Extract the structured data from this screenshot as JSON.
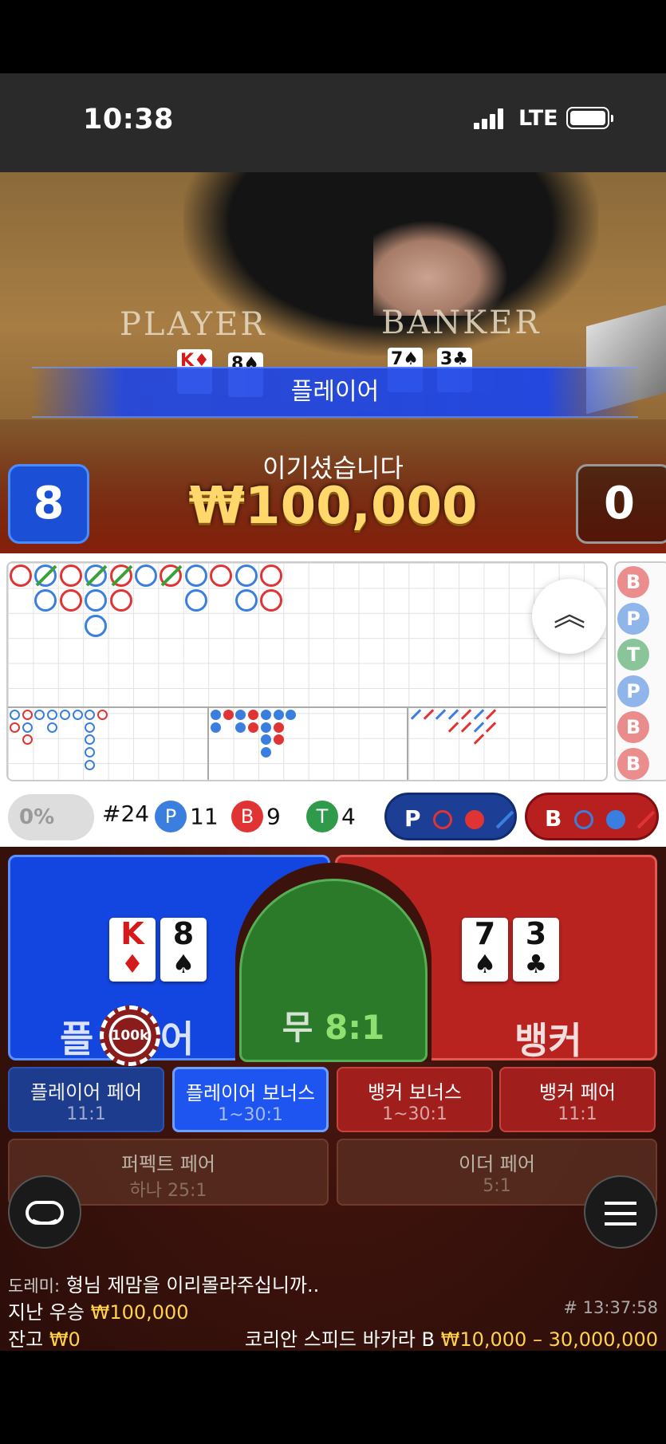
{
  "status": {
    "time": "10:38",
    "network": "LTE"
  },
  "table": {
    "player_label": "PLAYER",
    "banker_label": "BANKER"
  },
  "result": {
    "banner": "플레이어",
    "win_title": "이기셨습니다",
    "win_amount": "₩100,000",
    "player_score": "8",
    "banker_score": "0"
  },
  "stats": {
    "percent": "0%",
    "round": "#24",
    "player": {
      "badge": "P",
      "count": "11"
    },
    "banker": {
      "badge": "B",
      "count": "9"
    },
    "tie": {
      "badge": "T",
      "count": "4"
    },
    "ask_player": "P",
    "ask_banker": "B"
  },
  "prediction": [
    "B",
    "P",
    "T",
    "P",
    "B",
    "B"
  ],
  "bets": {
    "player": {
      "label_a": "플",
      "label_b": "어",
      "cards": [
        {
          "rank": "K",
          "suit": "♦"
        },
        {
          "rank": "8",
          "suit": "♠"
        }
      ]
    },
    "tie": {
      "label": "무",
      "odds": "8:1"
    },
    "banker": {
      "label": "뱅커",
      "cards": [
        {
          "rank": "7",
          "suit": "♠"
        },
        {
          "rank": "3",
          "suit": "♣"
        }
      ]
    },
    "chip": "100k"
  },
  "side_bets": [
    {
      "label": "플레이어 페어",
      "odds": "11:1"
    },
    {
      "label": "플레이어 보너스",
      "odds": "1~30:1"
    },
    {
      "label": "뱅커 보너스",
      "odds": "1~30:1"
    },
    {
      "label": "뱅커 페어",
      "odds": "11:1"
    }
  ],
  "wide_bets": [
    {
      "label": "퍼펙트 페어",
      "odds": "하나 25:1"
    },
    {
      "label": "이더 페어",
      "odds": "5:1"
    }
  ],
  "chat": {
    "name": "도레미:",
    "message": "형님 제맘을 이리몰라주십니까.."
  },
  "footer": {
    "last_win_label": "지난 우승",
    "last_win_value": "₩100,000",
    "balance_label": "잔고",
    "balance_value": "₩0",
    "game_id": "# 13:37:58",
    "table_name": "코리안 스피드 바카라 B",
    "limits": "₩10,000 – 30,000,000"
  },
  "colors": {
    "player": "#1346e0",
    "banker": "#b8231f",
    "tie": "#2a7a2a",
    "gold": "#ffd24a"
  }
}
